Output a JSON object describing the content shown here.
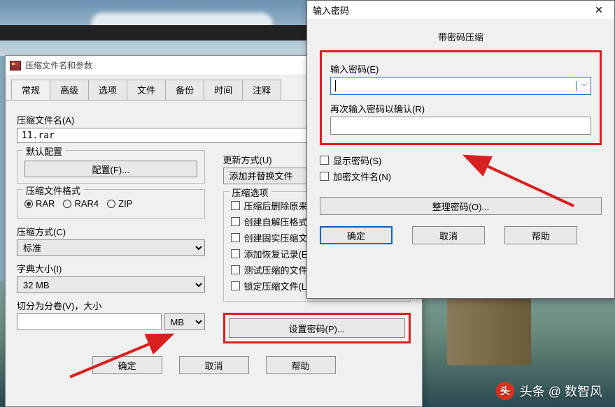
{
  "dlg1": {
    "title": "压缩文件名和参数",
    "tabs": [
      "常规",
      "高级",
      "选项",
      "文件",
      "备份",
      "时间",
      "注释"
    ],
    "activeTab": 0,
    "archiveNameLabel": "压缩文件名(A)",
    "archiveName": "11.rar",
    "defaultProfileLabel": "默认配置",
    "profileBtn": "配置(F)...",
    "updateModeLabel": "更新方式(U)",
    "updateMode": "添加并替换文件",
    "formatLabel": "压缩文件格式",
    "formats": [
      "RAR",
      "RAR4",
      "ZIP"
    ],
    "formatSelected": "RAR",
    "methodLabel": "压缩方式(C)",
    "methodValue": "标准",
    "dictLabel": "字典大小(I)",
    "dictValue": "32 MB",
    "splitLabel": "切分为分卷(V)，大小",
    "splitUnit": "MB",
    "optsLabel": "压缩选项",
    "opts": [
      "压缩后删除原来的文件",
      "创建自解压格式压缩文件",
      "创建固实压缩文件(S)",
      "添加恢复记录(E)",
      "测试压缩的文件(T)",
      "锁定压缩文件(L)"
    ],
    "setPwBtn": "设置密码(P)...",
    "ok": "确定",
    "cancel": "取消",
    "help": "帮助"
  },
  "dlg2": {
    "title": "输入密码",
    "subtitle": "带密码压缩",
    "pwLabel": "输入密码(E)",
    "pwConfirmLabel": "再次输入密码以确认(R)",
    "showPw": "显示密码(S)",
    "encryptNames": "加密文件名(N)",
    "organize": "整理密码(O)...",
    "ok": "确定",
    "cancel": "取消",
    "help": "帮助"
  },
  "watermark": "头条 @ 数智风"
}
